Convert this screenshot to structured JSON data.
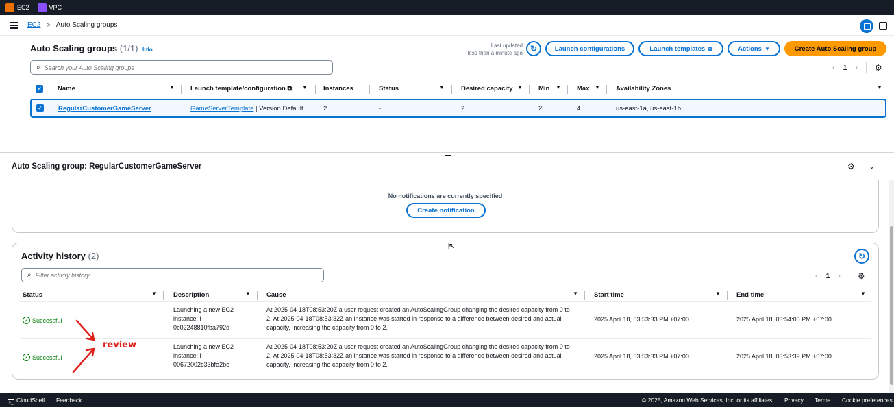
{
  "services": [
    {
      "label": "EC2"
    },
    {
      "label": "VPC"
    }
  ],
  "breadcrumb": {
    "root": "EC2",
    "separator": ">",
    "current": "Auto Scaling groups"
  },
  "groups_panel": {
    "title": "Auto Scaling groups",
    "count": "(1/1)",
    "info": "Info",
    "last_updated_label": "Last updated",
    "last_updated_value": "less than a minute ago",
    "launch_configurations": "Launch configurations",
    "launch_templates": "Launch templates",
    "actions": "Actions",
    "create_button": "Create Auto Scaling group",
    "search_placeholder": "Search your Auto Scaling groups",
    "page": "1",
    "columns": {
      "name": "Name",
      "template": "Launch template/configuration",
      "instances": "Instances",
      "status": "Status",
      "desired": "Desired capacity",
      "min": "Min",
      "max": "Max",
      "zones": "Availability Zones"
    },
    "row": {
      "name": "RegularCustomerGameServer",
      "template_link": "GameServerTemplate",
      "template_version": " | Version Default",
      "instances": "2",
      "status": "-",
      "desired": "2",
      "min": "2",
      "max": "4",
      "zones": "us-east-1a, us-east-1b"
    }
  },
  "details": {
    "title": "Auto Scaling group: RegularCustomerGameServer",
    "notifications_message": "No notifications are currently specified",
    "create_notification": "Create notification"
  },
  "activity": {
    "title": "Activity history",
    "count": "(2)",
    "filter_placeholder": "Filter activity history",
    "page": "1",
    "columns": {
      "status": "Status",
      "description": "Description",
      "cause": "Cause",
      "start": "Start time",
      "end": "End time"
    },
    "rows": [
      {
        "status": "Successful",
        "description": "Launching a new EC2 instance: i-0c02248810fba792d",
        "cause": "At 2025-04-18T08:53:20Z a user request created an AutoScalingGroup changing the desired capacity from 0 to 2. At 2025-04-18T08:53:32Z an instance was started in response to a difference between desired and actual capacity, increasing the capacity from 0 to 2.",
        "start": "2025 April 18, 03:53:33 PM +07:00",
        "end": "2025 April 18, 03:54:05 PM +07:00"
      },
      {
        "status": "Successful",
        "description": "Launching a new EC2 instance: i-00672002c33bfe2be",
        "cause": "At 2025-04-18T08:53:20Z a user request created an AutoScalingGroup changing the desired capacity from 0 to 2. At 2025-04-18T08:53:32Z an instance was started in response to a difference between desired and actual capacity, increasing the capacity from 0 to 2.",
        "start": "2025 April 18, 03:53:33 PM +07:00",
        "end": "2025 April 18, 03:53:39 PM +07:00"
      }
    ]
  },
  "annotation": {
    "text": "review",
    "color": "#e0201b"
  },
  "footer": {
    "cloudshell": "CloudShell",
    "feedback": "Feedback",
    "copyright": "© 2025, Amazon Web Services, Inc. or its affiliates.",
    "privacy": "Privacy",
    "terms": "Terms",
    "cookies": "Cookie preferences"
  },
  "colors": {
    "accent": "#0972d3",
    "primary_button": "#ff9900",
    "success": "#037f0c",
    "nav_bg": "#161d26"
  }
}
